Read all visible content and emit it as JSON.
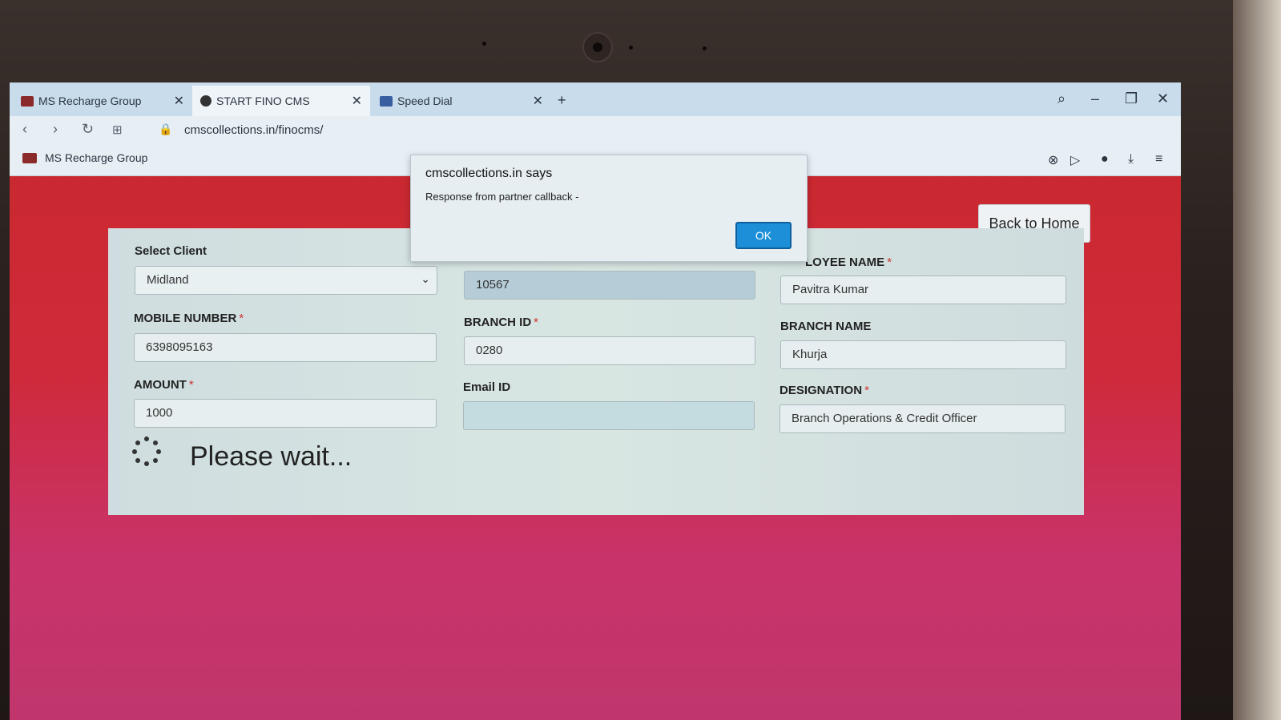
{
  "browser": {
    "tabs": [
      {
        "label": "MS Recharge Group",
        "close": "✕"
      },
      {
        "label": "START FINO CMS",
        "close": "✕"
      },
      {
        "label": "Speed Dial",
        "close": "✕"
      }
    ],
    "new_tab": "+",
    "url": "cmscollections.in/finocms/",
    "bookmark": "MS Recharge Group"
  },
  "page": {
    "back_home": "Back to Home",
    "form": {
      "select_client": {
        "label": "Select Client",
        "value": "Midland"
      },
      "employee_id": {
        "value": "10567"
      },
      "employee_name": {
        "label": "LOYEE NAME",
        "value": "Pavitra Kumar"
      },
      "mobile_number": {
        "label": "MOBILE NUMBER",
        "value": "6398095163"
      },
      "branch_id": {
        "label": "BRANCH ID",
        "value": "0280"
      },
      "branch_name": {
        "label": "BRANCH NAME",
        "value": "Khurja"
      },
      "amount": {
        "label": "AMOUNT",
        "value": "1000"
      },
      "email_id": {
        "label": "Email ID",
        "value": ""
      },
      "designation": {
        "label": "DESIGNATION",
        "value": "Branch Operations & Credit Officer"
      },
      "required_mark": "*"
    },
    "loading_text": "Please wait..."
  },
  "dialog": {
    "title": "cmscollections.in says",
    "message": "Response from partner callback -",
    "ok": "OK"
  },
  "colors": {
    "page_red": "#c8282c",
    "ok_button": "#1d8fd9"
  }
}
